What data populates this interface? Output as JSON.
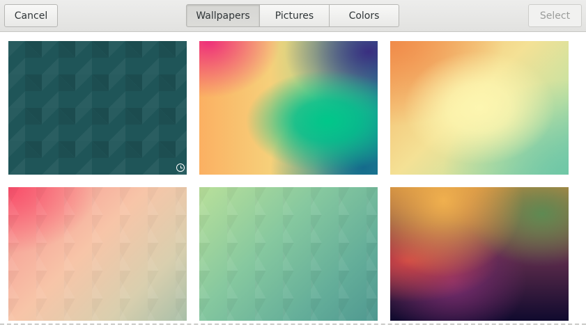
{
  "header": {
    "cancel_label": "Cancel",
    "select_label": "Select",
    "tabs": [
      {
        "label": "Wallpapers",
        "active": true
      },
      {
        "label": "Pictures",
        "active": false
      },
      {
        "label": "Colors",
        "active": false
      }
    ]
  },
  "wallpapers": [
    {
      "name": "dark-teal-triangles",
      "timed": true,
      "icon": "clock-icon"
    },
    {
      "name": "pink-yellow-green-blur",
      "timed": false
    },
    {
      "name": "orange-yellow-mint-blur",
      "timed": false
    },
    {
      "name": "pink-beige-triangles",
      "timed": false
    },
    {
      "name": "green-teal-triangles",
      "timed": false
    },
    {
      "name": "sunset-purple-blur",
      "timed": false
    }
  ],
  "colors": {
    "header_bg": "#e8e8e7",
    "active_tab_bg": "#d8d8d5",
    "text": "#2e3436",
    "disabled_text": "#9a9c9a"
  }
}
